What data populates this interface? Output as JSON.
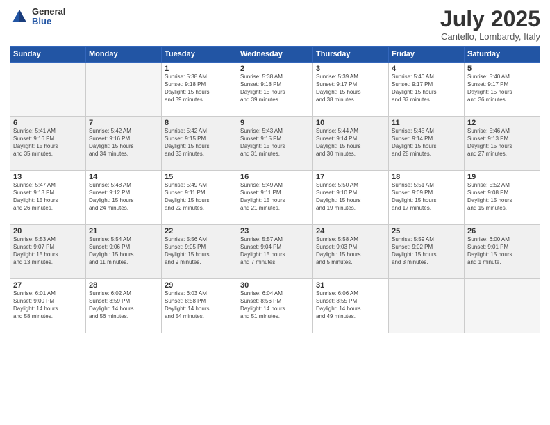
{
  "header": {
    "logo_general": "General",
    "logo_blue": "Blue",
    "month_title": "July 2025",
    "subtitle": "Cantello, Lombardy, Italy"
  },
  "weekdays": [
    "Sunday",
    "Monday",
    "Tuesday",
    "Wednesday",
    "Thursday",
    "Friday",
    "Saturday"
  ],
  "weeks": [
    [
      {
        "day": "",
        "info": ""
      },
      {
        "day": "",
        "info": ""
      },
      {
        "day": "1",
        "info": "Sunrise: 5:38 AM\nSunset: 9:18 PM\nDaylight: 15 hours\nand 39 minutes."
      },
      {
        "day": "2",
        "info": "Sunrise: 5:38 AM\nSunset: 9:18 PM\nDaylight: 15 hours\nand 39 minutes."
      },
      {
        "day": "3",
        "info": "Sunrise: 5:39 AM\nSunset: 9:17 PM\nDaylight: 15 hours\nand 38 minutes."
      },
      {
        "day": "4",
        "info": "Sunrise: 5:40 AM\nSunset: 9:17 PM\nDaylight: 15 hours\nand 37 minutes."
      },
      {
        "day": "5",
        "info": "Sunrise: 5:40 AM\nSunset: 9:17 PM\nDaylight: 15 hours\nand 36 minutes."
      }
    ],
    [
      {
        "day": "6",
        "info": "Sunrise: 5:41 AM\nSunset: 9:16 PM\nDaylight: 15 hours\nand 35 minutes."
      },
      {
        "day": "7",
        "info": "Sunrise: 5:42 AM\nSunset: 9:16 PM\nDaylight: 15 hours\nand 34 minutes."
      },
      {
        "day": "8",
        "info": "Sunrise: 5:42 AM\nSunset: 9:15 PM\nDaylight: 15 hours\nand 33 minutes."
      },
      {
        "day": "9",
        "info": "Sunrise: 5:43 AM\nSunset: 9:15 PM\nDaylight: 15 hours\nand 31 minutes."
      },
      {
        "day": "10",
        "info": "Sunrise: 5:44 AM\nSunset: 9:14 PM\nDaylight: 15 hours\nand 30 minutes."
      },
      {
        "day": "11",
        "info": "Sunrise: 5:45 AM\nSunset: 9:14 PM\nDaylight: 15 hours\nand 28 minutes."
      },
      {
        "day": "12",
        "info": "Sunrise: 5:46 AM\nSunset: 9:13 PM\nDaylight: 15 hours\nand 27 minutes."
      }
    ],
    [
      {
        "day": "13",
        "info": "Sunrise: 5:47 AM\nSunset: 9:13 PM\nDaylight: 15 hours\nand 26 minutes."
      },
      {
        "day": "14",
        "info": "Sunrise: 5:48 AM\nSunset: 9:12 PM\nDaylight: 15 hours\nand 24 minutes."
      },
      {
        "day": "15",
        "info": "Sunrise: 5:49 AM\nSunset: 9:11 PM\nDaylight: 15 hours\nand 22 minutes."
      },
      {
        "day": "16",
        "info": "Sunrise: 5:49 AM\nSunset: 9:11 PM\nDaylight: 15 hours\nand 21 minutes."
      },
      {
        "day": "17",
        "info": "Sunrise: 5:50 AM\nSunset: 9:10 PM\nDaylight: 15 hours\nand 19 minutes."
      },
      {
        "day": "18",
        "info": "Sunrise: 5:51 AM\nSunset: 9:09 PM\nDaylight: 15 hours\nand 17 minutes."
      },
      {
        "day": "19",
        "info": "Sunrise: 5:52 AM\nSunset: 9:08 PM\nDaylight: 15 hours\nand 15 minutes."
      }
    ],
    [
      {
        "day": "20",
        "info": "Sunrise: 5:53 AM\nSunset: 9:07 PM\nDaylight: 15 hours\nand 13 minutes."
      },
      {
        "day": "21",
        "info": "Sunrise: 5:54 AM\nSunset: 9:06 PM\nDaylight: 15 hours\nand 11 minutes."
      },
      {
        "day": "22",
        "info": "Sunrise: 5:56 AM\nSunset: 9:05 PM\nDaylight: 15 hours\nand 9 minutes."
      },
      {
        "day": "23",
        "info": "Sunrise: 5:57 AM\nSunset: 9:04 PM\nDaylight: 15 hours\nand 7 minutes."
      },
      {
        "day": "24",
        "info": "Sunrise: 5:58 AM\nSunset: 9:03 PM\nDaylight: 15 hours\nand 5 minutes."
      },
      {
        "day": "25",
        "info": "Sunrise: 5:59 AM\nSunset: 9:02 PM\nDaylight: 15 hours\nand 3 minutes."
      },
      {
        "day": "26",
        "info": "Sunrise: 6:00 AM\nSunset: 9:01 PM\nDaylight: 15 hours\nand 1 minute."
      }
    ],
    [
      {
        "day": "27",
        "info": "Sunrise: 6:01 AM\nSunset: 9:00 PM\nDaylight: 14 hours\nand 58 minutes."
      },
      {
        "day": "28",
        "info": "Sunrise: 6:02 AM\nSunset: 8:59 PM\nDaylight: 14 hours\nand 56 minutes."
      },
      {
        "day": "29",
        "info": "Sunrise: 6:03 AM\nSunset: 8:58 PM\nDaylight: 14 hours\nand 54 minutes."
      },
      {
        "day": "30",
        "info": "Sunrise: 6:04 AM\nSunset: 8:56 PM\nDaylight: 14 hours\nand 51 minutes."
      },
      {
        "day": "31",
        "info": "Sunrise: 6:06 AM\nSunset: 8:55 PM\nDaylight: 14 hours\nand 49 minutes."
      },
      {
        "day": "",
        "info": ""
      },
      {
        "day": "",
        "info": ""
      }
    ]
  ]
}
